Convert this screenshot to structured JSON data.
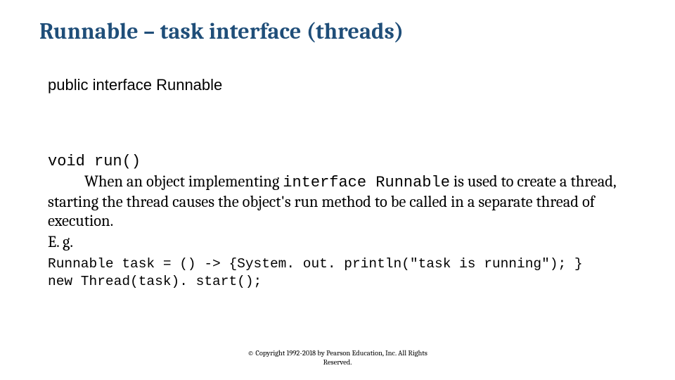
{
  "title": "Runnable – task interface (threads)",
  "subhead": "public interface Runnable",
  "body": {
    "method_signature": "void run()",
    "desc_prefix": "When an object implementing ",
    "desc_code": "interface Runnable",
    "desc_suffix": " is used to create a thread, starting the thread causes the object's run method to be called in a separate thread of execution.",
    "eg_label": "E. g.",
    "code_line1": "Runnable task = () -> {System. out. println(\"task is running\"); }",
    "code_line2": "new Thread(task). start();"
  },
  "footer": {
    "line1": "© Copyright 1992-2018 by Pearson Education, Inc. All Rights",
    "line2": "Reserved."
  }
}
